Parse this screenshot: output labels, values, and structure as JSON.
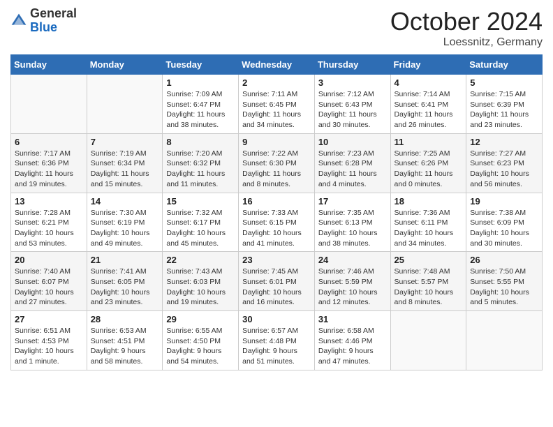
{
  "header": {
    "logo_general": "General",
    "logo_blue": "Blue",
    "month_title": "October 2024",
    "subtitle": "Loessnitz, Germany"
  },
  "weekdays": [
    "Sunday",
    "Monday",
    "Tuesday",
    "Wednesday",
    "Thursday",
    "Friday",
    "Saturday"
  ],
  "weeks": [
    [
      {
        "day": "",
        "info": ""
      },
      {
        "day": "",
        "info": ""
      },
      {
        "day": "1",
        "info": "Sunrise: 7:09 AM\nSunset: 6:47 PM\nDaylight: 11 hours and 38 minutes."
      },
      {
        "day": "2",
        "info": "Sunrise: 7:11 AM\nSunset: 6:45 PM\nDaylight: 11 hours and 34 minutes."
      },
      {
        "day": "3",
        "info": "Sunrise: 7:12 AM\nSunset: 6:43 PM\nDaylight: 11 hours and 30 minutes."
      },
      {
        "day": "4",
        "info": "Sunrise: 7:14 AM\nSunset: 6:41 PM\nDaylight: 11 hours and 26 minutes."
      },
      {
        "day": "5",
        "info": "Sunrise: 7:15 AM\nSunset: 6:39 PM\nDaylight: 11 hours and 23 minutes."
      }
    ],
    [
      {
        "day": "6",
        "info": "Sunrise: 7:17 AM\nSunset: 6:36 PM\nDaylight: 11 hours and 19 minutes."
      },
      {
        "day": "7",
        "info": "Sunrise: 7:19 AM\nSunset: 6:34 PM\nDaylight: 11 hours and 15 minutes."
      },
      {
        "day": "8",
        "info": "Sunrise: 7:20 AM\nSunset: 6:32 PM\nDaylight: 11 hours and 11 minutes."
      },
      {
        "day": "9",
        "info": "Sunrise: 7:22 AM\nSunset: 6:30 PM\nDaylight: 11 hours and 8 minutes."
      },
      {
        "day": "10",
        "info": "Sunrise: 7:23 AM\nSunset: 6:28 PM\nDaylight: 11 hours and 4 minutes."
      },
      {
        "day": "11",
        "info": "Sunrise: 7:25 AM\nSunset: 6:26 PM\nDaylight: 11 hours and 0 minutes."
      },
      {
        "day": "12",
        "info": "Sunrise: 7:27 AM\nSunset: 6:23 PM\nDaylight: 10 hours and 56 minutes."
      }
    ],
    [
      {
        "day": "13",
        "info": "Sunrise: 7:28 AM\nSunset: 6:21 PM\nDaylight: 10 hours and 53 minutes."
      },
      {
        "day": "14",
        "info": "Sunrise: 7:30 AM\nSunset: 6:19 PM\nDaylight: 10 hours and 49 minutes."
      },
      {
        "day": "15",
        "info": "Sunrise: 7:32 AM\nSunset: 6:17 PM\nDaylight: 10 hours and 45 minutes."
      },
      {
        "day": "16",
        "info": "Sunrise: 7:33 AM\nSunset: 6:15 PM\nDaylight: 10 hours and 41 minutes."
      },
      {
        "day": "17",
        "info": "Sunrise: 7:35 AM\nSunset: 6:13 PM\nDaylight: 10 hours and 38 minutes."
      },
      {
        "day": "18",
        "info": "Sunrise: 7:36 AM\nSunset: 6:11 PM\nDaylight: 10 hours and 34 minutes."
      },
      {
        "day": "19",
        "info": "Sunrise: 7:38 AM\nSunset: 6:09 PM\nDaylight: 10 hours and 30 minutes."
      }
    ],
    [
      {
        "day": "20",
        "info": "Sunrise: 7:40 AM\nSunset: 6:07 PM\nDaylight: 10 hours and 27 minutes."
      },
      {
        "day": "21",
        "info": "Sunrise: 7:41 AM\nSunset: 6:05 PM\nDaylight: 10 hours and 23 minutes."
      },
      {
        "day": "22",
        "info": "Sunrise: 7:43 AM\nSunset: 6:03 PM\nDaylight: 10 hours and 19 minutes."
      },
      {
        "day": "23",
        "info": "Sunrise: 7:45 AM\nSunset: 6:01 PM\nDaylight: 10 hours and 16 minutes."
      },
      {
        "day": "24",
        "info": "Sunrise: 7:46 AM\nSunset: 5:59 PM\nDaylight: 10 hours and 12 minutes."
      },
      {
        "day": "25",
        "info": "Sunrise: 7:48 AM\nSunset: 5:57 PM\nDaylight: 10 hours and 8 minutes."
      },
      {
        "day": "26",
        "info": "Sunrise: 7:50 AM\nSunset: 5:55 PM\nDaylight: 10 hours and 5 minutes."
      }
    ],
    [
      {
        "day": "27",
        "info": "Sunrise: 6:51 AM\nSunset: 4:53 PM\nDaylight: 10 hours and 1 minute."
      },
      {
        "day": "28",
        "info": "Sunrise: 6:53 AM\nSunset: 4:51 PM\nDaylight: 9 hours and 58 minutes."
      },
      {
        "day": "29",
        "info": "Sunrise: 6:55 AM\nSunset: 4:50 PM\nDaylight: 9 hours and 54 minutes."
      },
      {
        "day": "30",
        "info": "Sunrise: 6:57 AM\nSunset: 4:48 PM\nDaylight: 9 hours and 51 minutes."
      },
      {
        "day": "31",
        "info": "Sunrise: 6:58 AM\nSunset: 4:46 PM\nDaylight: 9 hours and 47 minutes."
      },
      {
        "day": "",
        "info": ""
      },
      {
        "day": "",
        "info": ""
      }
    ]
  ]
}
